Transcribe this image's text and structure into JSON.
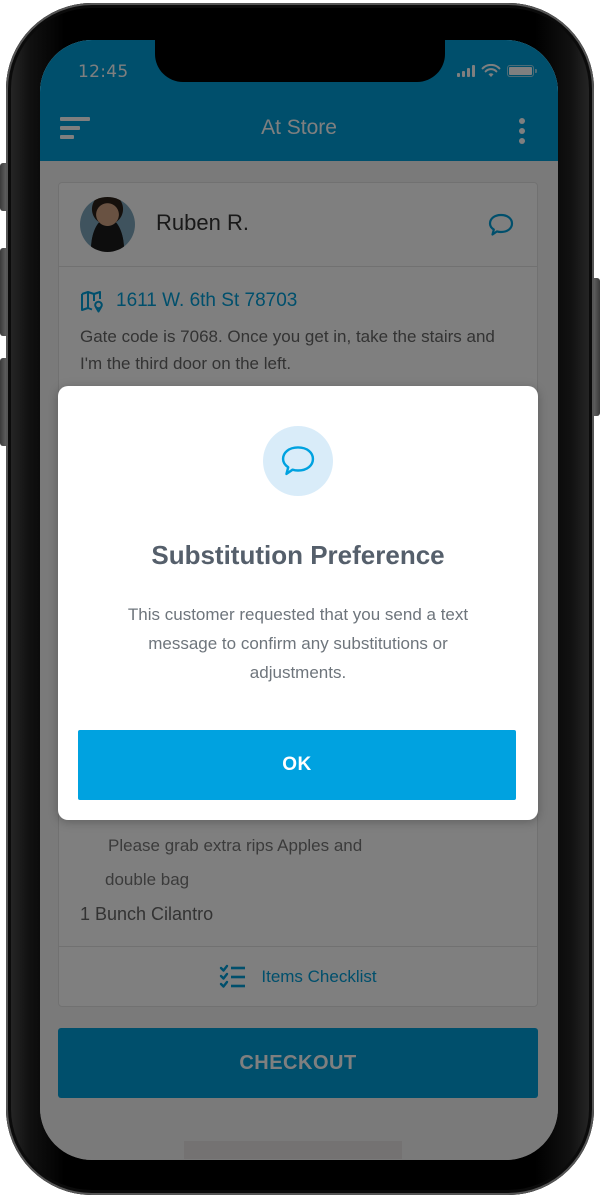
{
  "status_bar": {
    "time": "12:45"
  },
  "header": {
    "title": "At Store",
    "menu_icon": "menu-icon",
    "more_icon": "kebab-icon"
  },
  "customer": {
    "name": "Ruben R.",
    "chat_icon": "chat-bubble-icon"
  },
  "address": {
    "icon": "map-pin-icon",
    "text": "1611 W. 6th St 78703",
    "note": "Gate code is 7068. Once you get in, take the stairs and I'm the third door on the left."
  },
  "items": {
    "note_line1": "Please grab extra rips Apples and",
    "note_line2": "double bag",
    "item": "1 Bunch Cilantro"
  },
  "checklist": {
    "icon": "checklist-icon",
    "label": "Items Checklist"
  },
  "checkout": {
    "label": "CHECKOUT"
  },
  "modal": {
    "icon": "chat-bubble-icon",
    "title": "Substitution Preference",
    "body": "This customer requested that you send a text message to confirm any substitutions or adjustments.",
    "ok_label": "OK"
  },
  "colors": {
    "brand": "#009ed8",
    "modal_button": "#00a2e0",
    "icon_circle": "#d9ecf9",
    "title_text": "#555f6b"
  }
}
